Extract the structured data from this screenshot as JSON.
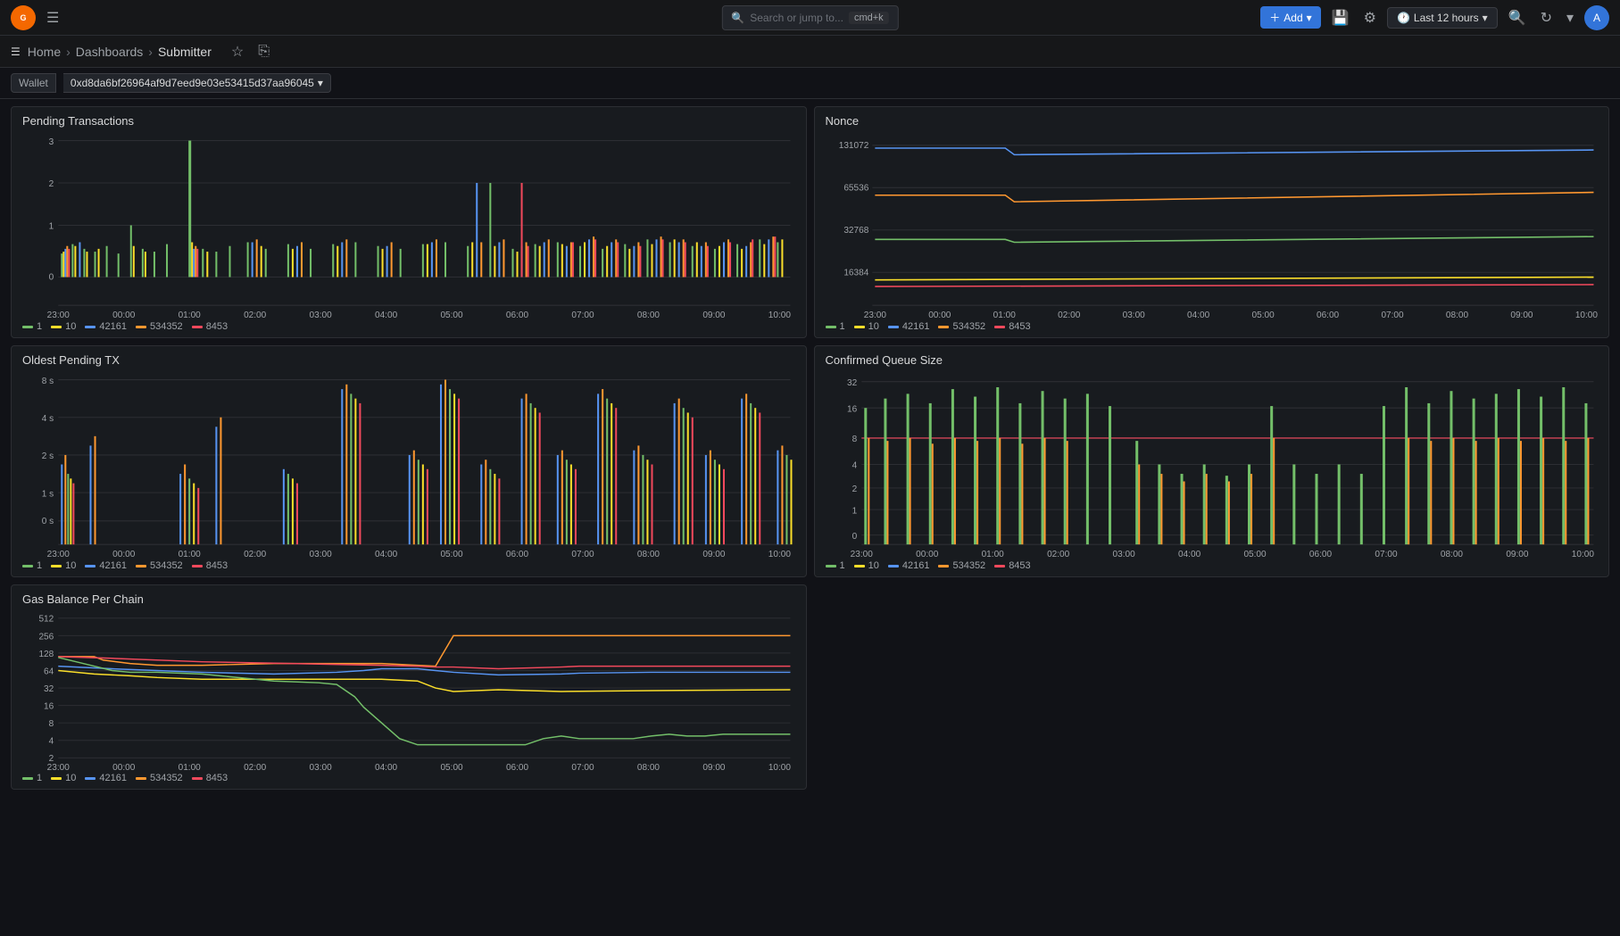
{
  "app": {
    "logo": "G",
    "logo_color": "#f46800"
  },
  "topbar": {
    "search_placeholder": "Search or jump to...",
    "shortcut": "cmd+k",
    "add_label": "Add",
    "time_range": "Last 12 hours",
    "avatar_initials": "A"
  },
  "navbar": {
    "menu_icon": "☰",
    "breadcrumbs": [
      "Home",
      "Dashboards",
      "Submitter"
    ],
    "star_icon": "★",
    "share_icon": "⎘"
  },
  "variables": {
    "wallet_label": "Wallet",
    "wallet_value": "0xd8da6bf26964af9d7eed9e03e53415d37aa96045",
    "chevron": "▾"
  },
  "panels": {
    "pending_tx": {
      "title": "Pending Transactions",
      "y_labels": [
        "3",
        "2",
        "1",
        "0"
      ],
      "x_labels": [
        "23:00",
        "00:00",
        "01:00",
        "02:00",
        "03:00",
        "04:00",
        "05:00",
        "06:00",
        "07:00",
        "08:00",
        "09:00",
        "10:00"
      ],
      "legend": [
        {
          "label": "1",
          "color": "#73bf69"
        },
        {
          "label": "10",
          "color": "#fade2a"
        },
        {
          "label": "42161",
          "color": "#5794f2"
        },
        {
          "label": "534352",
          "color": "#ff9830"
        },
        {
          "label": "8453",
          "color": "#f2495c"
        }
      ]
    },
    "nonce": {
      "title": "Nonce",
      "y_labels": [
        "131072",
        "65536",
        "32768",
        "16384"
      ],
      "x_labels": [
        "23:00",
        "00:00",
        "01:00",
        "02:00",
        "03:00",
        "04:00",
        "05:00",
        "06:00",
        "07:00",
        "08:00",
        "09:00",
        "10:00"
      ],
      "legend": [
        {
          "label": "1",
          "color": "#73bf69"
        },
        {
          "label": "10",
          "color": "#fade2a"
        },
        {
          "label": "42161",
          "color": "#5794f2"
        },
        {
          "label": "534352",
          "color": "#ff9830"
        },
        {
          "label": "8453",
          "color": "#f2495c"
        }
      ]
    },
    "oldest_pending": {
      "title": "Oldest Pending TX",
      "y_labels": [
        "8 s",
        "4 s",
        "2 s",
        "1 s",
        "0 s"
      ],
      "x_labels": [
        "23:00",
        "00:00",
        "01:00",
        "02:00",
        "03:00",
        "04:00",
        "05:00",
        "06:00",
        "07:00",
        "08:00",
        "09:00",
        "10:00"
      ],
      "legend": [
        {
          "label": "1",
          "color": "#73bf69"
        },
        {
          "label": "10",
          "color": "#fade2a"
        },
        {
          "label": "42161",
          "color": "#5794f2"
        },
        {
          "label": "534352",
          "color": "#ff9830"
        },
        {
          "label": "8453",
          "color": "#f2495c"
        }
      ]
    },
    "confirmed_queue": {
      "title": "Confirmed Queue Size",
      "y_labels": [
        "32",
        "16",
        "8",
        "4",
        "2",
        "1",
        "0"
      ],
      "x_labels": [
        "23:00",
        "00:00",
        "01:00",
        "02:00",
        "03:00",
        "04:00",
        "05:00",
        "06:00",
        "07:00",
        "08:00",
        "09:00",
        "10:00"
      ],
      "legend": [
        {
          "label": "1",
          "color": "#73bf69"
        },
        {
          "label": "10",
          "color": "#fade2a"
        },
        {
          "label": "42161",
          "color": "#5794f2"
        },
        {
          "label": "534352",
          "color": "#ff9830"
        },
        {
          "label": "8453",
          "color": "#f2495c"
        }
      ]
    },
    "gas_balance": {
      "title": "Gas Balance Per Chain",
      "y_labels": [
        "512",
        "256",
        "128",
        "64",
        "32",
        "16",
        "8",
        "4",
        "2"
      ],
      "x_labels": [
        "23:00",
        "00:00",
        "01:00",
        "02:00",
        "03:00",
        "04:00",
        "05:00",
        "06:00",
        "07:00",
        "08:00",
        "09:00",
        "10:00"
      ],
      "legend": [
        {
          "label": "1",
          "color": "#73bf69"
        },
        {
          "label": "10",
          "color": "#fade2a"
        },
        {
          "label": "42161",
          "color": "#5794f2"
        },
        {
          "label": "534352",
          "color": "#ff9830"
        },
        {
          "label": "8453",
          "color": "#f2495c"
        }
      ]
    }
  },
  "colors": {
    "green": "#73bf69",
    "yellow": "#fade2a",
    "blue": "#5794f2",
    "orange": "#ff9830",
    "red": "#f2495c",
    "bg": "#111217",
    "panel_bg": "#181b1f",
    "border": "#2c2e33",
    "text_primary": "#d8d9da",
    "text_secondary": "#9fa3a8"
  }
}
